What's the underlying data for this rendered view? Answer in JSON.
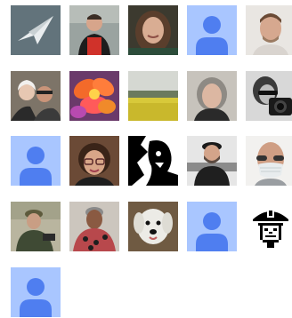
{
  "contributors": [
    {
      "icon": "paper-plane-photo-avatar",
      "kind": "photo"
    },
    {
      "icon": "person-red-shirt-photo-avatar",
      "kind": "photo"
    },
    {
      "icon": "woman-smiling-photo-avatar",
      "kind": "photo"
    },
    {
      "icon": "default-user-avatar",
      "kind": "placeholder"
    },
    {
      "icon": "man-portrait-photo-avatar",
      "kind": "photo"
    },
    {
      "icon": "two-people-selfie-photo-avatar",
      "kind": "photo"
    },
    {
      "icon": "cactus-flower-photo-avatar",
      "kind": "photo"
    },
    {
      "icon": "yellow-field-landscape-photo-avatar",
      "kind": "photo"
    },
    {
      "icon": "woman-gray-hair-photo-avatar",
      "kind": "photo"
    },
    {
      "icon": "photographer-camera-photo-avatar",
      "kind": "photo"
    },
    {
      "icon": "default-user-avatar",
      "kind": "placeholder"
    },
    {
      "icon": "woman-glasses-photo-avatar",
      "kind": "photo"
    },
    {
      "icon": "black-white-silhouette-avatar",
      "kind": "photo"
    },
    {
      "icon": "man-cap-beard-photo-avatar",
      "kind": "photo"
    },
    {
      "icon": "person-face-mask-photo-avatar",
      "kind": "photo"
    },
    {
      "icon": "man-cap-outdoors-photo-avatar",
      "kind": "photo"
    },
    {
      "icon": "man-patterned-shirt-photo-avatar",
      "kind": "photo"
    },
    {
      "icon": "white-dog-photo-avatar",
      "kind": "photo"
    },
    {
      "icon": "default-user-avatar",
      "kind": "placeholder"
    },
    {
      "icon": "pixel-helmet-face-avatar",
      "kind": "icon"
    },
    {
      "icon": "default-user-avatar",
      "kind": "placeholder"
    }
  ],
  "colors": {
    "placeholder_bg": "#a9c6ff",
    "placeholder_figure": "#4f7ef0",
    "page_bg": "#ffffff"
  }
}
